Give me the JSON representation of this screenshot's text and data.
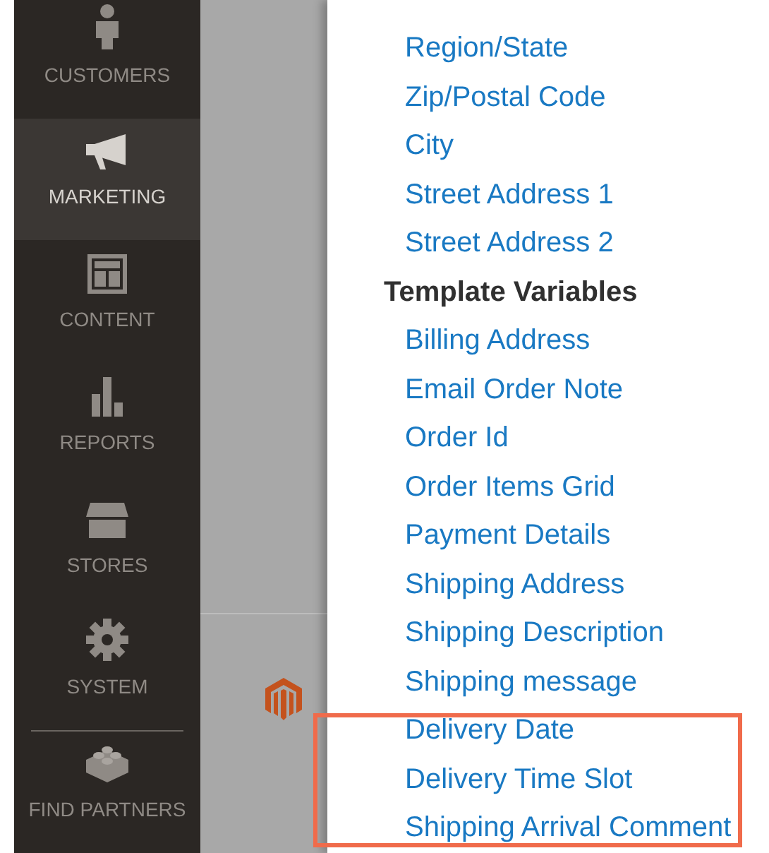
{
  "sidebar": {
    "items": [
      {
        "label": "CUSTOMERS",
        "selected": false
      },
      {
        "label": "MARKETING",
        "selected": true
      },
      {
        "label": "CONTENT",
        "selected": false
      },
      {
        "label": "REPORTS",
        "selected": false
      },
      {
        "label": "STORES",
        "selected": false
      },
      {
        "label": "SYSTEM",
        "selected": false
      },
      {
        "label": "FIND PARTNERS",
        "selected": false
      }
    ]
  },
  "address_variables": [
    "Region/State",
    "Zip/Postal Code",
    "City",
    "Street Address 1",
    "Street Address 2"
  ],
  "template_variables": {
    "heading": "Template Variables",
    "items": [
      {
        "label": "Billing Address",
        "highlighted": false
      },
      {
        "label": "Email Order Note",
        "highlighted": false
      },
      {
        "label": "Order Id",
        "highlighted": false
      },
      {
        "label": "Order Items Grid",
        "highlighted": false
      },
      {
        "label": "Payment Details",
        "highlighted": false
      },
      {
        "label": "Shipping Address",
        "highlighted": false
      },
      {
        "label": "Shipping Description",
        "highlighted": false
      },
      {
        "label": "Shipping message",
        "highlighted": false
      },
      {
        "label": "Delivery Date",
        "highlighted": true
      },
      {
        "label": "Delivery Time Slot",
        "highlighted": true
      },
      {
        "label": "Shipping Arrival Comment",
        "highlighted": true
      }
    ]
  }
}
